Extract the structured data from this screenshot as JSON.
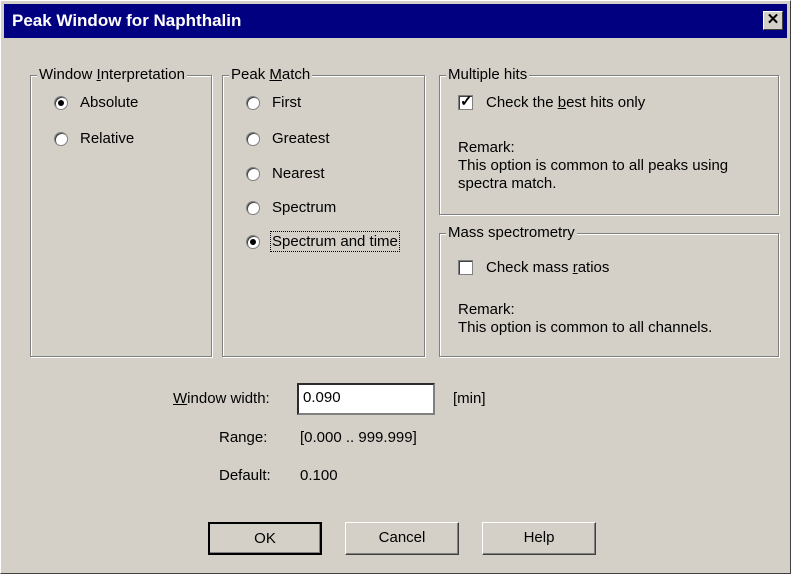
{
  "window": {
    "title": "Peak Window for Naphthalin",
    "close_glyph": "✕"
  },
  "window_interpretation": {
    "label_pre": "Window ",
    "label_u": "I",
    "label_post": "nterpretation",
    "options": [
      {
        "label": "Absolute",
        "selected": true
      },
      {
        "label": "Relative",
        "selected": false
      }
    ]
  },
  "peak_match": {
    "label_pre": "Peak ",
    "label_u": "M",
    "label_post": "atch",
    "options": [
      {
        "label": "First",
        "selected": false
      },
      {
        "label": "Greatest",
        "selected": false
      },
      {
        "label": "Nearest",
        "selected": false
      },
      {
        "label": "Spectrum",
        "selected": false
      },
      {
        "label": "Spectrum and time",
        "selected": true
      }
    ]
  },
  "multiple_hits": {
    "label": "Multiple hits",
    "checkbox_pre": "Check the ",
    "checkbox_u": "b",
    "checkbox_post": "est hits only",
    "checked": true,
    "remark_title": "Remark:",
    "remark_line1": "This option is common to all peaks using",
    "remark_line2": "spectra match."
  },
  "mass_spectrometry": {
    "label": "Mass spectrometry",
    "checkbox_pre": "Check mass ",
    "checkbox_u": "r",
    "checkbox_post": "atios",
    "checked": false,
    "remark_title": "Remark:",
    "remark_line1": "This option is common to all channels."
  },
  "window_width": {
    "label_u": "W",
    "label_post": "indow width:",
    "value": "0.090",
    "unit": "[min]",
    "range_label": "Range:",
    "range_value": "[0.000 .. 999.999]",
    "default_label": "Default:",
    "default_value": "0.100"
  },
  "buttons": {
    "ok": "OK",
    "cancel": "Cancel",
    "help": "Help"
  }
}
